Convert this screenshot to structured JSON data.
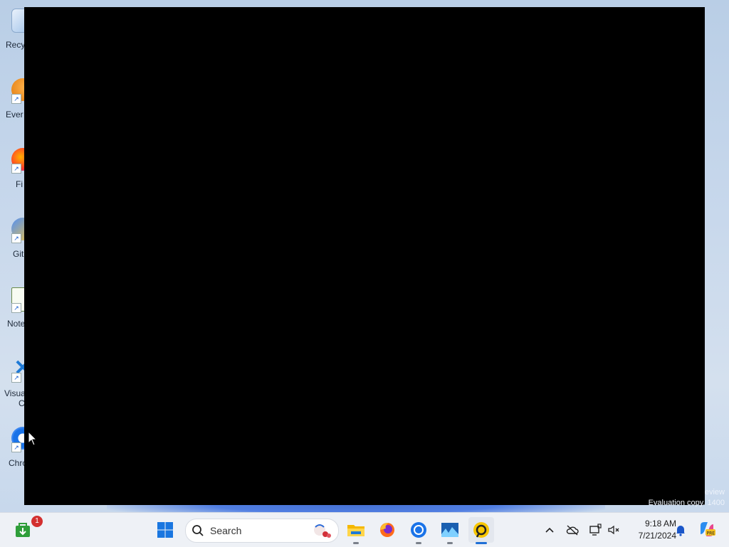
{
  "desktop": {
    "icons": [
      {
        "label": "Recy",
        "icon": "recycle-bin-icon"
      },
      {
        "label": "Ever",
        "icon": "everything-icon"
      },
      {
        "label": "Fi",
        "icon": "firefox-icon"
      },
      {
        "label": "Git",
        "icon": "git-icon"
      },
      {
        "label": "Note",
        "icon": "notepad-icon"
      },
      {
        "label": "Visua",
        "label2": "C",
        "icon": "vscode-icon"
      },
      {
        "label": "Chro",
        "icon": "chrome-icon"
      }
    ],
    "watermark_line1": "eview",
    "watermark_line2": "Evaluation copy. 1400"
  },
  "taskbar": {
    "store_badge": "1",
    "search_placeholder": "Search",
    "time": "9:18 AM",
    "date": "7/21/2024",
    "apps": [
      "windows-start-icon",
      "file-explorer-icon",
      "firefox-icon",
      "chrome-icon",
      "photo-viewer-icon",
      "unknown-app-icon"
    ]
  },
  "colors": {
    "taskbar_bg": "#eef1f6",
    "accent": "#1f6fd6",
    "window_bg": "#000000"
  }
}
